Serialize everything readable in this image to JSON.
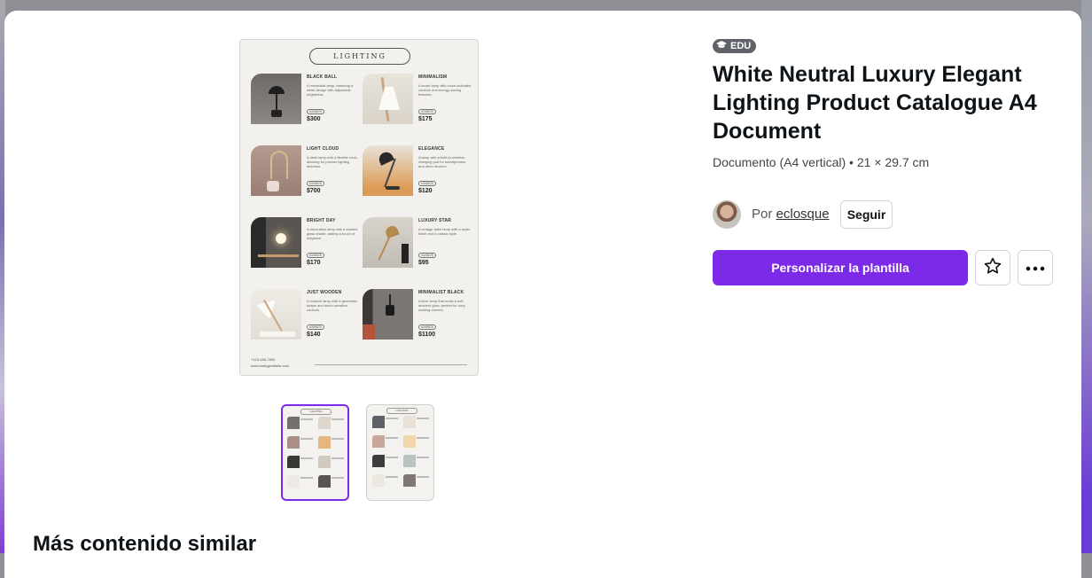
{
  "preview": {
    "doc_title": "LIGHTING",
    "items": [
      {
        "name": "BLACK BALL",
        "desc": "A minimalist lamp, featuring a sleek design with adjustable brightness.",
        "badge": "#345678",
        "price": "$300"
      },
      {
        "name": "MINIMALISM",
        "desc": "A smart lamp with voice-activated controls and energy-saving features.",
        "badge": "#345678",
        "price": "$175"
      },
      {
        "name": "LIGHT CLOUD",
        "desc": "A desk lamp with a flexible neck, allowing for precise lighting direction.",
        "badge": "#345678",
        "price": "$700"
      },
      {
        "name": "ELEGANCE",
        "desc": "A lamp with a built-in wireless charging pad for smartphones and other devices.",
        "badge": "#345678",
        "price": "$120"
      },
      {
        "name": "BRIGHT DAY",
        "desc": "A decorative lamp with a stained glass shade, adding a touch of elegance.",
        "badge": "#345678",
        "price": "$170"
      },
      {
        "name": "LUXURY STAR",
        "desc": "A vintage table lamp with a rustic finish and a classic style.",
        "badge": "#345678",
        "price": "$95"
      },
      {
        "name": "JUST WOODEN",
        "desc": "A modern lamp with a geometric shape and touch-sensitive controls.",
        "badge": "#345678",
        "price": "$140"
      },
      {
        "name": "MINIMALIST BLACK",
        "desc": "A floor lamp that emits a soft, ambient glow, perfect for cozy reading corners.",
        "badge": "#345678",
        "price": "$1100"
      }
    ],
    "footer_phone": "+123-456-7890",
    "footer_site": "www.reallygreatsite.com"
  },
  "thumbnails": [
    {
      "label": "LIGHTING",
      "selected": true
    },
    {
      "label": "LIGHTING",
      "selected": false
    }
  ],
  "template": {
    "badge": "EDU",
    "title": "White Neutral Luxury Elegant Lighting Product Catalogue A4 Document",
    "subtitle": "Documento (A4 vertical) • 21 × 29.7 cm",
    "author_prefix": "Por",
    "author_name": "eclosque",
    "follow_label": "Seguir",
    "cta_label": "Personalizar la plantilla"
  },
  "icons": {
    "badge": "graduation-cap-icon",
    "favorite": "star-icon",
    "more": "more-horizontal-icon"
  },
  "colors": {
    "accent": "#7d2ae8",
    "badge_bg": "#5f6368"
  },
  "section": {
    "title": "Más contenido similar"
  }
}
